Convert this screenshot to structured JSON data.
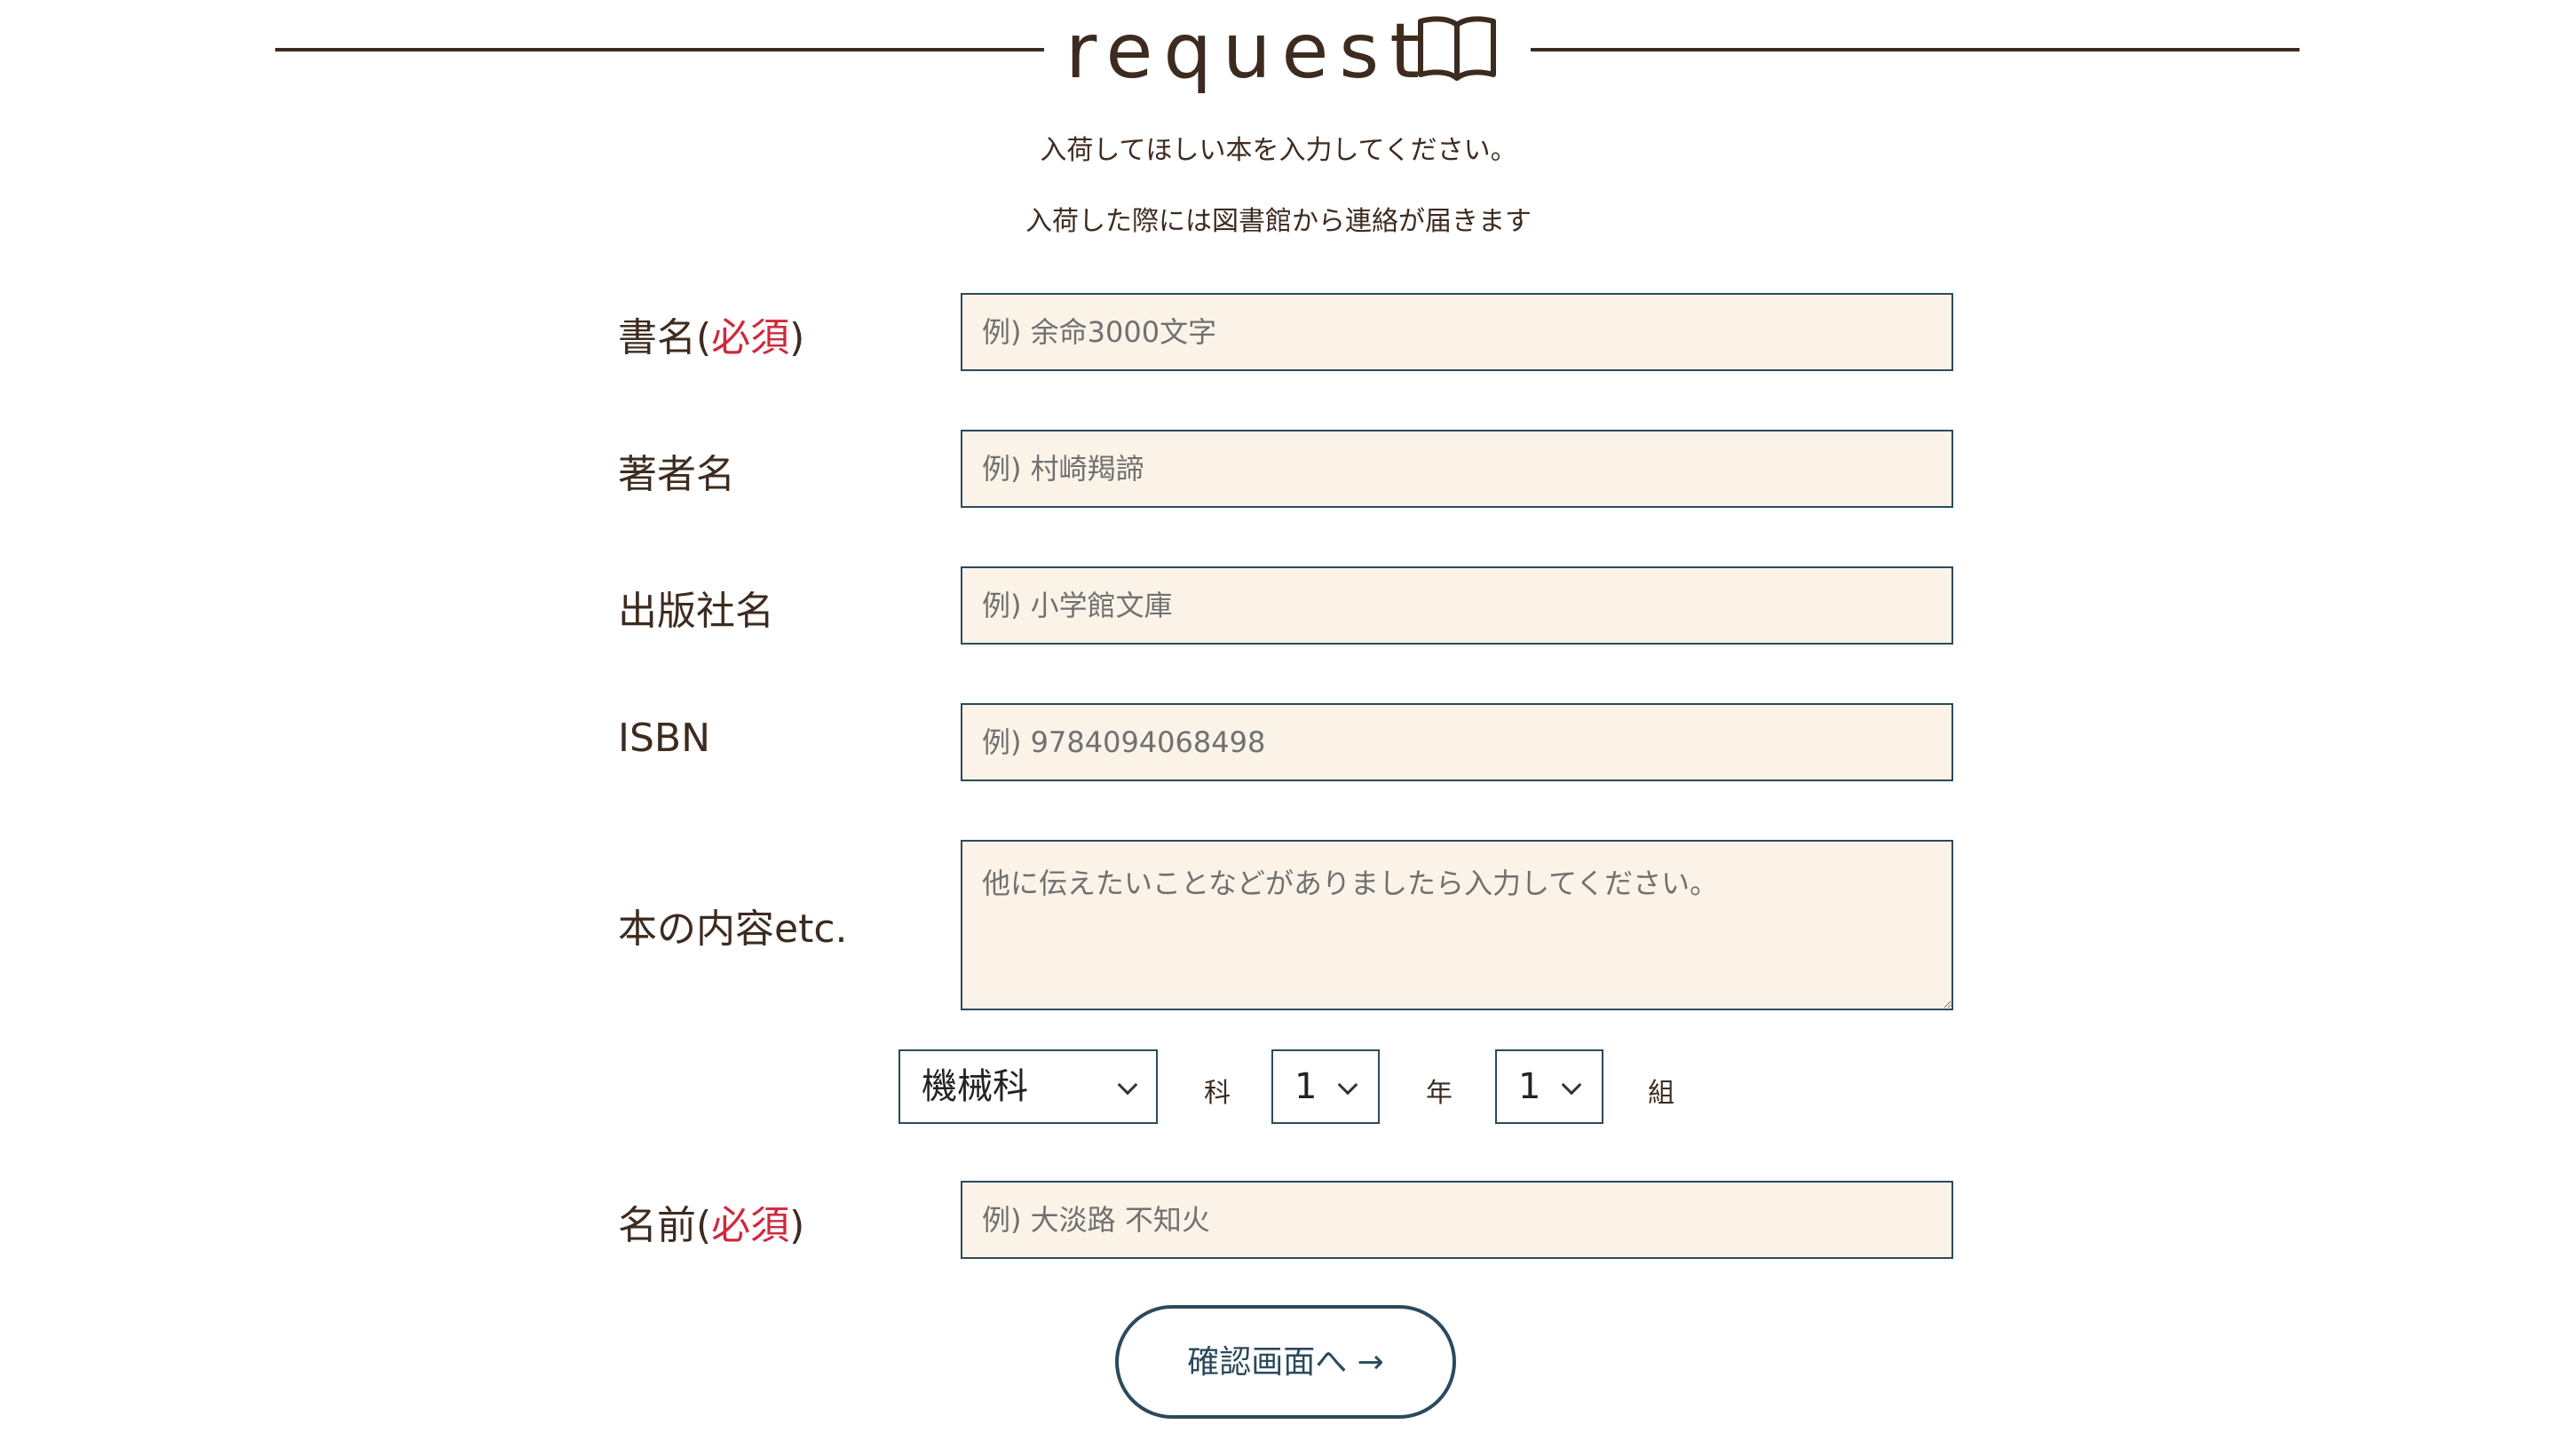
{
  "heading": {
    "title": "request",
    "icon": "open-book-icon"
  },
  "intro": {
    "line1": "入荷してほしい本を入力してください。",
    "line2": "入荷した際には図書館から連絡が届きます"
  },
  "form": {
    "title_field": {
      "label": "書名(",
      "required": "必須",
      "label_close": ")",
      "placeholder": "例) 余命3000文字"
    },
    "author_field": {
      "label": "著者名",
      "placeholder": "例) 村崎羯諦"
    },
    "publisher_field": {
      "label": "出版社名",
      "placeholder": "例) 小学館文庫"
    },
    "isbn_field": {
      "label": "ISBN",
      "placeholder": "例) 9784094068498"
    },
    "content_field": {
      "label": "本の内容etc.",
      "placeholder": "他に伝えたいことなどがありましたら入力してください。"
    },
    "class_selector": {
      "department_value": "機械科",
      "department_unit": "科",
      "year_value": "1",
      "year_unit": "年",
      "class_value": "1",
      "class_unit": "組"
    },
    "name_field": {
      "label": "名前(",
      "required": "必須",
      "label_close": ")",
      "placeholder": "例) 大淡路 不知火"
    },
    "submit_label": "確認画面へ →"
  },
  "colors": {
    "text": "#3d2b1f",
    "required": "#d0283c",
    "field_background": "#fcf3e8",
    "field_border": "#2b4a5c",
    "button_text": "#2b4a5c"
  }
}
